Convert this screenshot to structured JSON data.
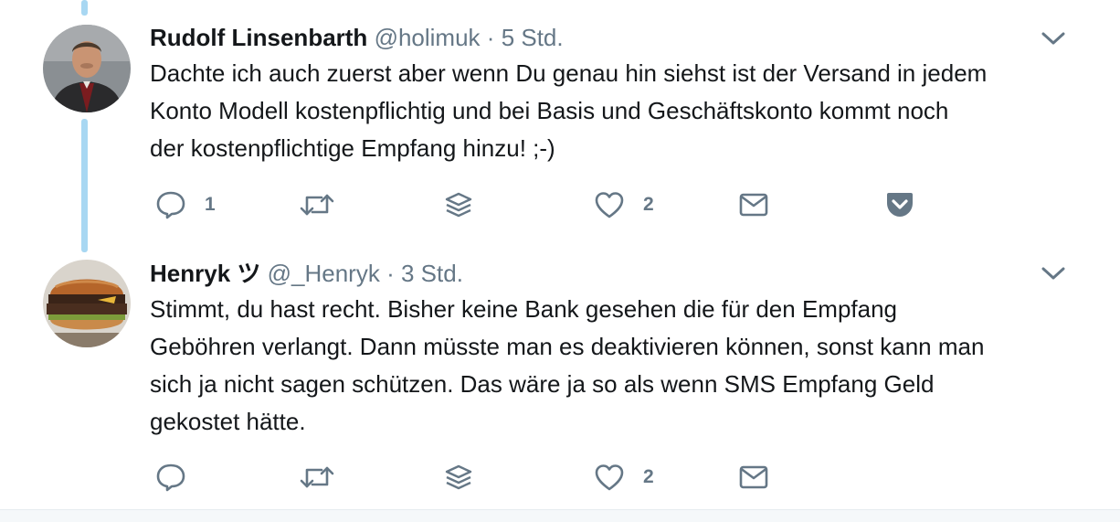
{
  "colors": {
    "thread_line": "#a8d7f2",
    "meta_text": "#657786",
    "body_text": "#14171a"
  },
  "tweets": [
    {
      "author_name": "Rudolf Linsenbarth",
      "handle": "@holimuk",
      "separator": "·",
      "time": "5 Std.",
      "text_lines": [
        "Dachte ich auch zuerst aber wenn Du genau hin siehst ist der Versand in jedem",
        "Konto Modell kostenpflichtig und bei Basis und Geschäftskonto kommt noch",
        "der kostenpflichtige Empfang hinzu! ;-)"
      ],
      "reply_count": "1",
      "like_count": "2",
      "icons": [
        "reply-icon",
        "retweet-icon",
        "layers-icon",
        "heart-icon",
        "mail-icon",
        "pocket-icon"
      ]
    },
    {
      "author_name": "Henryk ツ",
      "handle": "@_Henryk",
      "separator": "·",
      "time": "3 Std.",
      "text_lines": [
        "Stimmt, du hast recht. Bisher keine Bank gesehen die für den Empfang",
        "Geböhren verlangt. Dann müsste man es deaktivieren können, sonst kann man",
        "sich ja nicht sagen schützen. Das wäre ja so als wenn SMS Empfang Geld",
        "gekostet hätte."
      ],
      "reply_count": "",
      "like_count": "2",
      "icons": [
        "reply-icon",
        "retweet-icon",
        "layers-icon",
        "heart-icon",
        "mail-icon"
      ]
    }
  ]
}
